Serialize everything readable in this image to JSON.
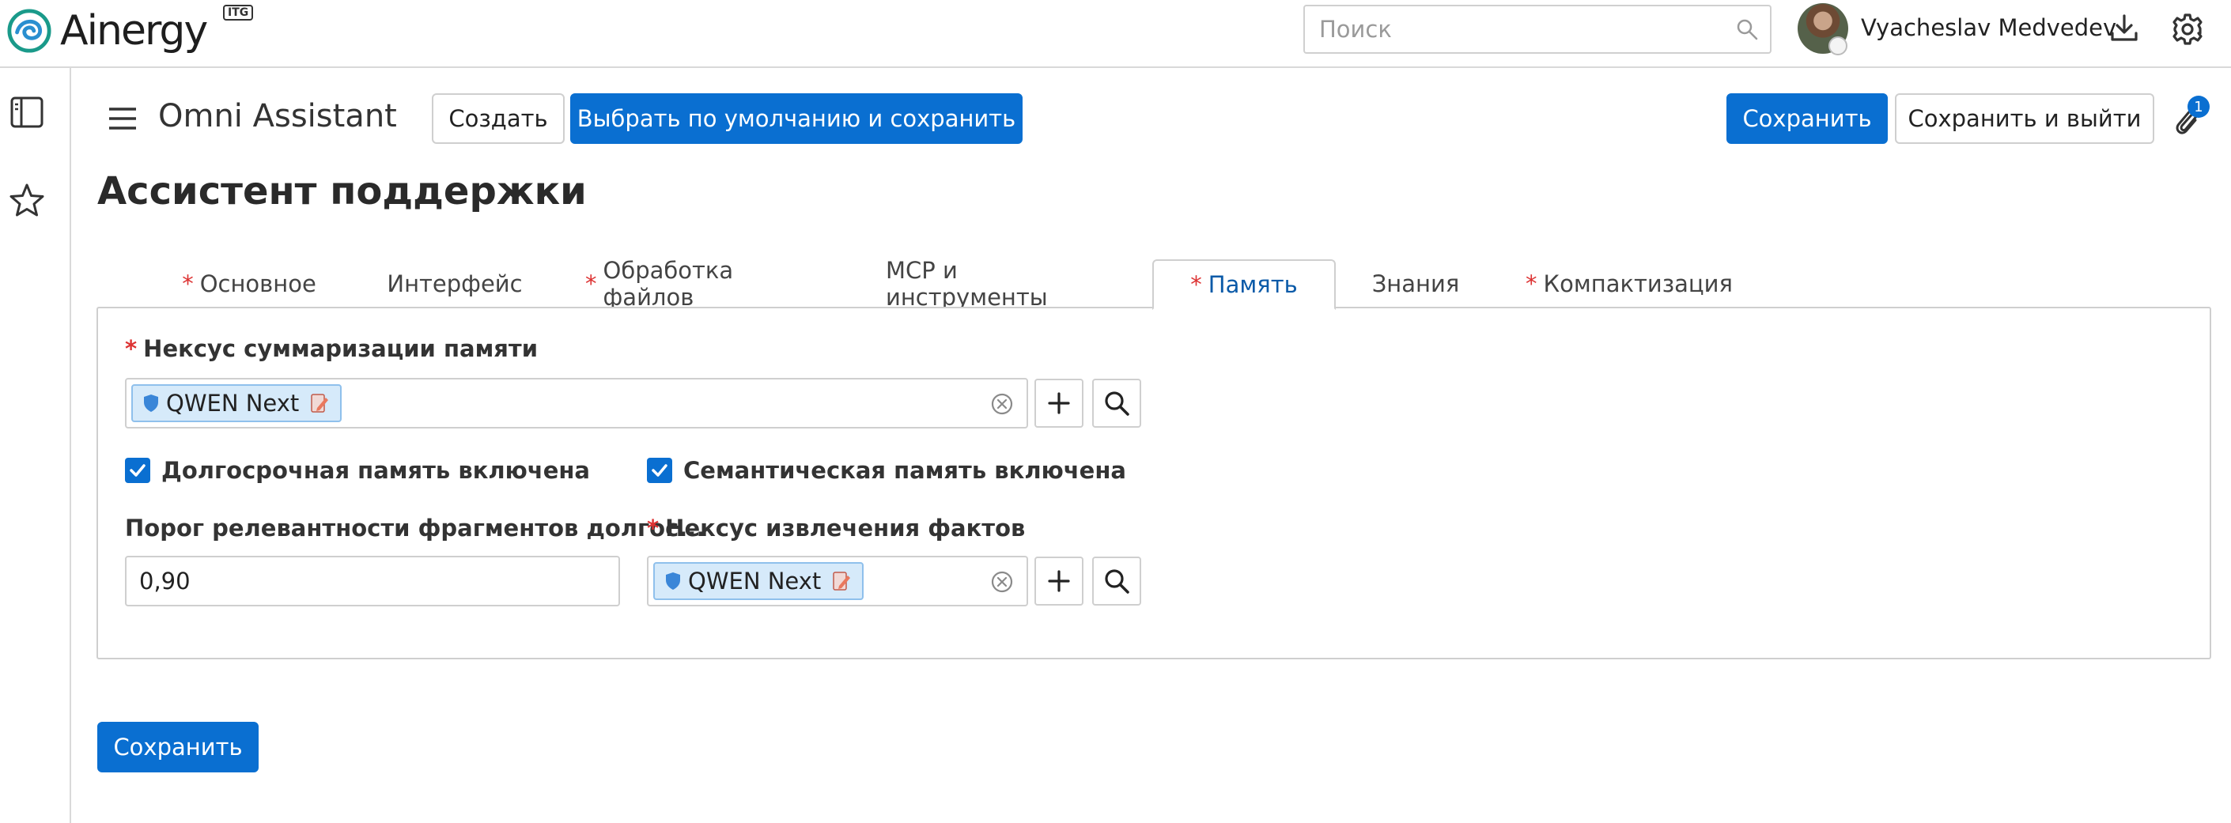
{
  "header": {
    "logo_text": "Ainergy",
    "logo_badge": "ITG",
    "search_placeholder": "Поиск",
    "user_name": "Vyacheslav Medvedev"
  },
  "toolbar": {
    "app_title": "Omni Assistant",
    "create_label": "Создать",
    "default_save_label": "Выбрать по умолчанию и сохранить",
    "save_label": "Сохранить",
    "save_exit_label": "Сохранить и выйти",
    "attachments_count": "1"
  },
  "page": {
    "title": "Ассистент поддержки"
  },
  "tabs": [
    {
      "label": "Основное",
      "required": true,
      "active": false
    },
    {
      "label": "Интерфейс",
      "required": false,
      "active": false
    },
    {
      "label": "Обработка файлов",
      "required": true,
      "active": false
    },
    {
      "label": "MCP и инструменты",
      "required": false,
      "active": false
    },
    {
      "label": "Память",
      "required": true,
      "active": true
    },
    {
      "label": "Знания",
      "required": false,
      "active": false
    },
    {
      "label": "Компактизация",
      "required": true,
      "active": false
    }
  ],
  "form": {
    "summarization_nexus": {
      "label": "Нексус суммаризации памяти",
      "required": true,
      "value": "QWEN Next"
    },
    "long_term_memory": {
      "label": "Долгосрочная память включена",
      "checked": true
    },
    "semantic_memory": {
      "label": "Семантическая память включена",
      "checked": true
    },
    "relevance_threshold": {
      "label": "Порог релевантности фрагментов долгос...",
      "value": "0,90"
    },
    "fact_extraction_nexus": {
      "label": "Нексус извлечения фактов",
      "required": true,
      "value": "QWEN Next"
    }
  },
  "footer": {
    "save_label": "Сохранить"
  },
  "colors": {
    "primary": "#0a6fd1",
    "required_marker": "#d33333",
    "active_tab_text": "#0a5aa8",
    "chip_bg": "#d6eafa"
  }
}
